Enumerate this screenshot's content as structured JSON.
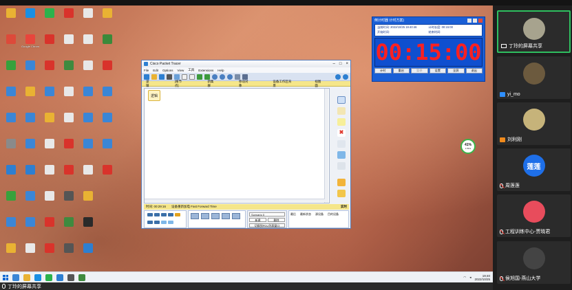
{
  "bottom_bar": {
    "share_label": "丁玲的屏幕共享"
  },
  "desktop_icons": [
    {
      "label": "",
      "color": "#e9b233",
      "col": 0,
      "row": 0
    },
    {
      "label": "",
      "color": "#1a8fe3",
      "col": 1,
      "row": 0
    },
    {
      "label": "",
      "color": "#2bb24c",
      "col": 2,
      "row": 0
    },
    {
      "label": "",
      "color": "#d9332b",
      "col": 3,
      "row": 0
    },
    {
      "label": "",
      "color": "#e8e8e8",
      "col": 4,
      "row": 0
    },
    {
      "label": "",
      "color": "#e9b233",
      "col": 5,
      "row": 0
    },
    {
      "label": "",
      "color": "#dd4a3a",
      "col": 0,
      "row": 1
    },
    {
      "label": "Google Chrome",
      "color": "#e8453c",
      "col": 1,
      "row": 1
    },
    {
      "label": "",
      "color": "#d9332b",
      "col": 2,
      "row": 1
    },
    {
      "label": "",
      "color": "#e8e8e8",
      "col": 3,
      "row": 1
    },
    {
      "label": "",
      "color": "#e8e8e8",
      "col": 4,
      "row": 1
    },
    {
      "label": "",
      "color": "#3a8a3a",
      "col": 5,
      "row": 1
    },
    {
      "label": "",
      "color": "#37a13c",
      "col": 0,
      "row": 2
    },
    {
      "label": "",
      "color": "#3b86d6",
      "col": 1,
      "row": 2
    },
    {
      "label": "",
      "color": "#d9332b",
      "col": 2,
      "row": 2
    },
    {
      "label": "",
      "color": "#3f8a3f",
      "col": 3,
      "row": 2
    },
    {
      "label": "",
      "color": "#e8e8e8",
      "col": 4,
      "row": 2
    },
    {
      "label": "",
      "color": "#d9332b",
      "col": 5,
      "row": 2
    },
    {
      "label": "",
      "color": "#3b86d6",
      "col": 0,
      "row": 3
    },
    {
      "label": "",
      "color": "#e9b233",
      "col": 1,
      "row": 3
    },
    {
      "label": "",
      "color": "#3b86d6",
      "col": 2,
      "row": 3
    },
    {
      "label": "",
      "color": "#e8e8e8",
      "col": 3,
      "row": 3
    },
    {
      "label": "",
      "color": "#3b86d6",
      "col": 4,
      "row": 3
    },
    {
      "label": "",
      "color": "#3b86d6",
      "col": 5,
      "row": 3
    },
    {
      "label": "",
      "color": "#3b86d6",
      "col": 0,
      "row": 4
    },
    {
      "label": "",
      "color": "#3b86d6",
      "col": 1,
      "row": 4
    },
    {
      "label": "",
      "color": "#e9b233",
      "col": 2,
      "row": 4
    },
    {
      "label": "",
      "color": "#e8e8e8",
      "col": 3,
      "row": 4
    },
    {
      "label": "",
      "color": "#3b86d6",
      "col": 4,
      "row": 4
    },
    {
      "label": "",
      "color": "#3b86d6",
      "col": 5,
      "row": 4
    },
    {
      "label": "",
      "color": "#8a8a8a",
      "col": 0,
      "row": 5
    },
    {
      "label": "",
      "color": "#3b86d6",
      "col": 1,
      "row": 5
    },
    {
      "label": "",
      "color": "#e8e8e8",
      "col": 2,
      "row": 5
    },
    {
      "label": "",
      "color": "#d9332b",
      "col": 3,
      "row": 5
    },
    {
      "label": "",
      "color": "#3b86d6",
      "col": 4,
      "row": 5
    },
    {
      "label": "",
      "color": "#3b86d6",
      "col": 5,
      "row": 5
    },
    {
      "label": "",
      "color": "#2d7fd1",
      "col": 0,
      "row": 6
    },
    {
      "label": "",
      "color": "#2d7fd1",
      "col": 1,
      "row": 6
    },
    {
      "label": "",
      "color": "#e8e8e8",
      "col": 2,
      "row": 6
    },
    {
      "label": "",
      "color": "#d9332b",
      "col": 3,
      "row": 6
    },
    {
      "label": "",
      "color": "#e8e8e8",
      "col": 4,
      "row": 6
    },
    {
      "label": "",
      "color": "#d9332b",
      "col": 5,
      "row": 6
    },
    {
      "label": "",
      "color": "#37a13c",
      "col": 0,
      "row": 7
    },
    {
      "label": "",
      "color": "#3b86d6",
      "col": 1,
      "row": 7
    },
    {
      "label": "",
      "color": "#e8e8e8",
      "col": 2,
      "row": 7
    },
    {
      "label": "",
      "color": "#555555",
      "col": 3,
      "row": 7
    },
    {
      "label": "",
      "color": "#e9b233",
      "col": 4,
      "row": 7
    },
    {
      "label": "",
      "color": "#3b86d6",
      "col": 0,
      "row": 8
    },
    {
      "label": "",
      "color": "#3b86d6",
      "col": 1,
      "row": 8
    },
    {
      "label": "",
      "color": "#d9332b",
      "col": 2,
      "row": 8
    },
    {
      "label": "",
      "color": "#3f8a3f",
      "col": 3,
      "row": 8
    },
    {
      "label": "",
      "color": "#2a2a2a",
      "col": 4,
      "row": 8
    },
    {
      "label": "",
      "color": "#e9b233",
      "col": 0,
      "row": 9
    },
    {
      "label": "",
      "color": "#e8e8e8",
      "col": 1,
      "row": 9
    },
    {
      "label": "",
      "color": "#d9332b",
      "col": 2,
      "row": 9
    },
    {
      "label": "",
      "color": "#555555",
      "col": 3,
      "row": 9
    },
    {
      "label": "",
      "color": "#2d7fd1",
      "col": 4,
      "row": 9
    }
  ],
  "packet_tracer": {
    "title": "Cisco Packet Tracer",
    "menu": [
      "File",
      "Edit",
      "Options",
      "View",
      "工具",
      "Extensions",
      "Help"
    ],
    "workspace_bar": [
      "逻辑",
      "[根节点]",
      "新集群",
      "移动对象",
      "设备工作区背景",
      "视图面"
    ],
    "logical_label": "逻辑",
    "status_time": "时间: 00:29:16",
    "status_text": "设备重新加电  Fast Forward Time",
    "realtime_label": "实时",
    "scenario_select": "Scenario 0",
    "btn_new": "新建",
    "btn_delete": "删除",
    "btn_toggle_pdu": "切换到PDU列表窗口",
    "pdu_headers": [
      "最后",
      "最新状态",
      "源设备",
      "目的设备"
    ]
  },
  "timer": {
    "title": "倒计时器  计时方案)",
    "start_time_label": "当前时间:",
    "start_time_value": "2022/10/25 19:40:46",
    "setting_label": "计时长度:",
    "setting_value": "00:15:00",
    "begin_label": "开始时间:",
    "end_label": "结束时间:",
    "display": "00:15:00",
    "buttons": [
      "计时",
      "重启",
      "暂停",
      "设置",
      "全屏",
      "退出"
    ]
  },
  "perf_widget": {
    "value": "41%",
    "sub": "1.5K/s"
  },
  "taskbar": {
    "time": "19:40",
    "date": "2022/10/25"
  },
  "participants": [
    {
      "name": "丁玲的屏幕共享",
      "avatar_color": "#a7a38e",
      "avatar_text": "",
      "badge": "screen",
      "active": true
    },
    {
      "name": "yi_mo",
      "avatar_color": "#6c5a3e",
      "avatar_text": "",
      "badge": "user-blue",
      "active": false
    },
    {
      "name": "刘利刚",
      "avatar_color": "#c6b37a",
      "avatar_text": "",
      "badge": "user-orange",
      "active": false
    },
    {
      "name": "周莲莲",
      "avatar_color": "#1e6fe8",
      "avatar_text": "莲莲",
      "badge": "mic-muted",
      "active": false
    },
    {
      "name": "工程训练中心-贾晓君",
      "avatar_color": "#e84c5c",
      "avatar_text": "",
      "badge": "mic-muted",
      "active": false
    },
    {
      "name": "侯旭国-燕山大学",
      "avatar_color": "#444444",
      "avatar_text": "",
      "badge": "mic-muted",
      "active": false
    }
  ]
}
